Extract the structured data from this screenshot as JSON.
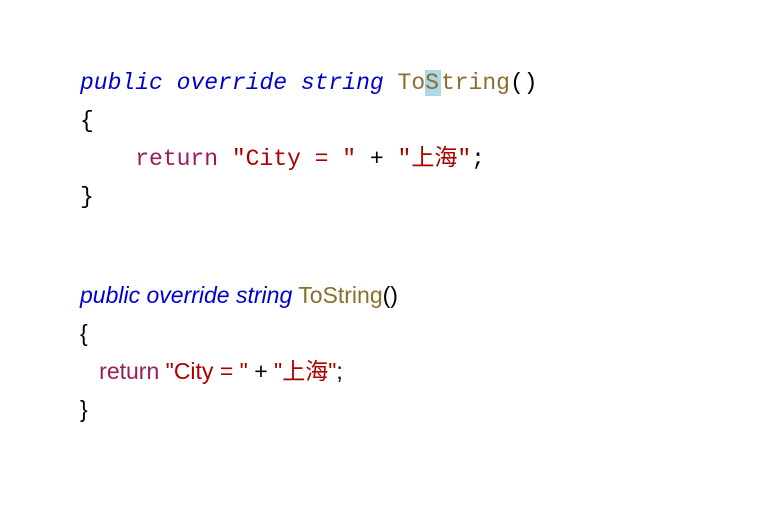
{
  "block1": {
    "line1": {
      "kw1": "public",
      "kw2": "override",
      "kw3": "string",
      "method": "ToString",
      "parens": "()"
    },
    "line2": {
      "brace": "{"
    },
    "line3": {
      "return": "return",
      "str1": "\"City = \"",
      "op": " + ",
      "str2": "\"上海\"",
      "semi": ";"
    },
    "line4": {
      "brace": "}"
    }
  },
  "block2": {
    "line1": {
      "kw1": "public",
      "kw2": "override",
      "kw3": "string",
      "method": "ToString",
      "parens": "()"
    },
    "line2": {
      "brace": "{"
    },
    "line3": {
      "return": "return",
      "str1": "\"City = \"",
      "op": " + ",
      "str2": "\"上海\"",
      "semi": ";"
    },
    "line4": {
      "brace": "}"
    }
  }
}
